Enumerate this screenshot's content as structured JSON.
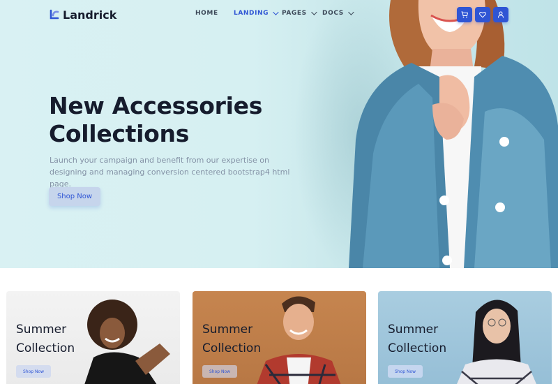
{
  "brand": {
    "name": "Landrick",
    "accent": "#2f55d4"
  },
  "nav": {
    "items": [
      {
        "label": "HOME",
        "active": false,
        "dropdown": false
      },
      {
        "label": "LANDING",
        "active": true,
        "dropdown": true
      },
      {
        "label": "PAGES",
        "active": false,
        "dropdown": true
      },
      {
        "label": "DOCS",
        "active": false,
        "dropdown": true
      }
    ],
    "icons": [
      "cart-icon",
      "heart-icon",
      "user-icon"
    ]
  },
  "hero": {
    "title_line1": "New Accessories",
    "title_line2": "Collections",
    "subtitle": "Launch your campaign and benefit from our expertise on designing and managing conversion centered bootstrap4 html page.",
    "cta": "Shop Now"
  },
  "cards": [
    {
      "line1": "Summer",
      "line2": "Collection",
      "cta": "Shop Now"
    },
    {
      "line1": "Summer",
      "line2": "Collection",
      "cta": "Shop Now"
    },
    {
      "line1": "Summer",
      "line2": "Collection",
      "cta": "Shop Now"
    }
  ]
}
